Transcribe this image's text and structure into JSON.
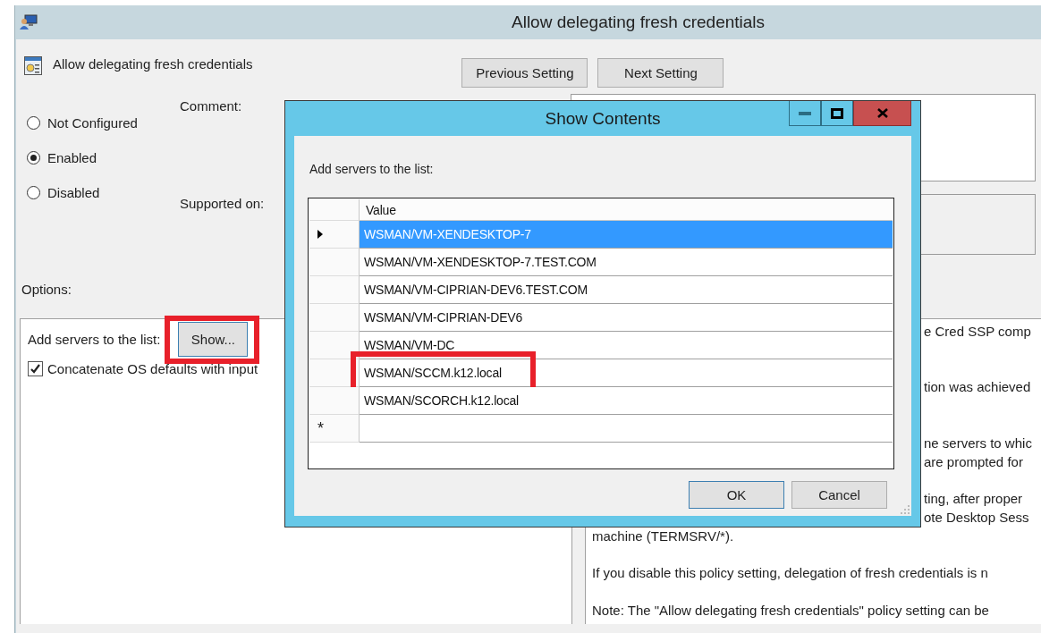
{
  "main_window": {
    "title": "Allow delegating fresh credentials"
  },
  "policy": {
    "name": "Allow delegating fresh credentials"
  },
  "nav_buttons": [
    "Previous Setting",
    "Next Setting"
  ],
  "states": [
    {
      "label": "Not Configured",
      "selected": false
    },
    {
      "label": "Enabled",
      "selected": true
    },
    {
      "label": "Disabled",
      "selected": false
    }
  ],
  "fields": {
    "comment_label": "Comment:",
    "supported_label": "Supported on:"
  },
  "options": {
    "label": "Options:",
    "servers_label": "Add servers to the list:",
    "show_button": {
      "label": "Show...",
      "highlighted": true
    },
    "concatenate": {
      "label": "Concatenate OS defaults with input",
      "checked": true
    }
  },
  "help_lines": [
    {
      "kind": "partial",
      "text": "e Cred SSP comp"
    },
    {
      "kind": "hidden"
    },
    {
      "kind": "hidden"
    },
    {
      "kind": "partial",
      "text": "tion was achieved"
    },
    {
      "kind": "hidden"
    },
    {
      "kind": "hidden"
    },
    {
      "kind": "partial",
      "text": "ne servers to whic"
    },
    {
      "kind": "partial",
      "text": "are prompted for"
    },
    {
      "kind": "hidden"
    },
    {
      "kind": "partial",
      "text": "ting, after proper"
    },
    {
      "kind": "partial",
      "text": "ote Desktop Sess"
    },
    {
      "kind": "full",
      "text": "machine (TERMSRV/*)."
    },
    {
      "kind": "hidden"
    },
    {
      "kind": "full",
      "text": "If you disable this policy setting, delegation of fresh credentials is n"
    },
    {
      "kind": "hidden"
    },
    {
      "kind": "full",
      "text": "Note: The \"Allow delegating fresh credentials\" policy setting can be"
    }
  ],
  "dialog": {
    "title": "Show Contents",
    "prompt": "Add servers to the list:",
    "column": "Value",
    "rows": [
      {
        "value": "WSMAN/VM-XENDESKTOP-7",
        "selected": true,
        "highlighted": false
      },
      {
        "value": "WSMAN/VM-XENDESKTOP-7.TEST.COM",
        "selected": false,
        "highlighted": false
      },
      {
        "value": "WSMAN/VM-CIPRIAN-DEV6.TEST.COM",
        "selected": false,
        "highlighted": false
      },
      {
        "value": "WSMAN/VM-CIPRIAN-DEV6",
        "selected": false,
        "highlighted": false
      },
      {
        "value": "WSMAN/VM-DC",
        "selected": false,
        "highlighted": false
      },
      {
        "value": "WSMAN/SCCM.k12.local",
        "selected": false,
        "highlighted": true
      },
      {
        "value": "WSMAN/SCORCH.k12.local",
        "selected": false,
        "highlighted": false
      }
    ],
    "new_row_marker": "*",
    "buttons": [
      {
        "label": "OK",
        "kind": "default"
      },
      {
        "label": "Cancel",
        "kind": "normal"
      }
    ]
  }
}
